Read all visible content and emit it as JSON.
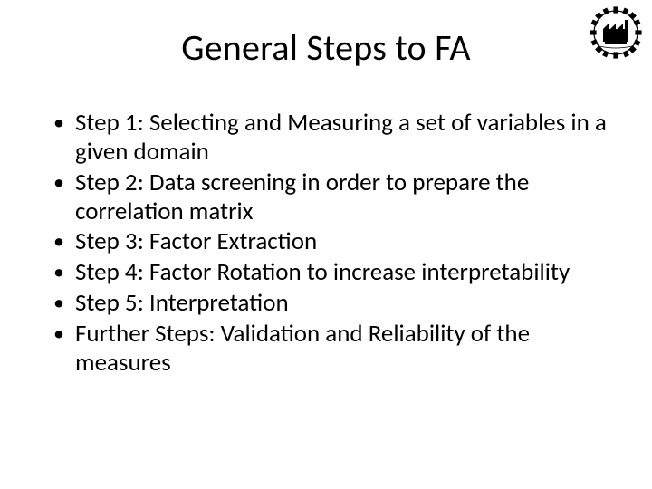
{
  "title": "General Steps to FA",
  "bullets": [
    "Step 1: Selecting and Measuring a set of variables in a given domain",
    "Step 2: Data screening in order to prepare the correlation matrix",
    "Step 3: Factor Extraction",
    "Step 4: Factor Rotation to increase interpretability",
    "Step 5: Interpretation",
    "Further Steps: Validation and Reliability of the measures"
  ]
}
